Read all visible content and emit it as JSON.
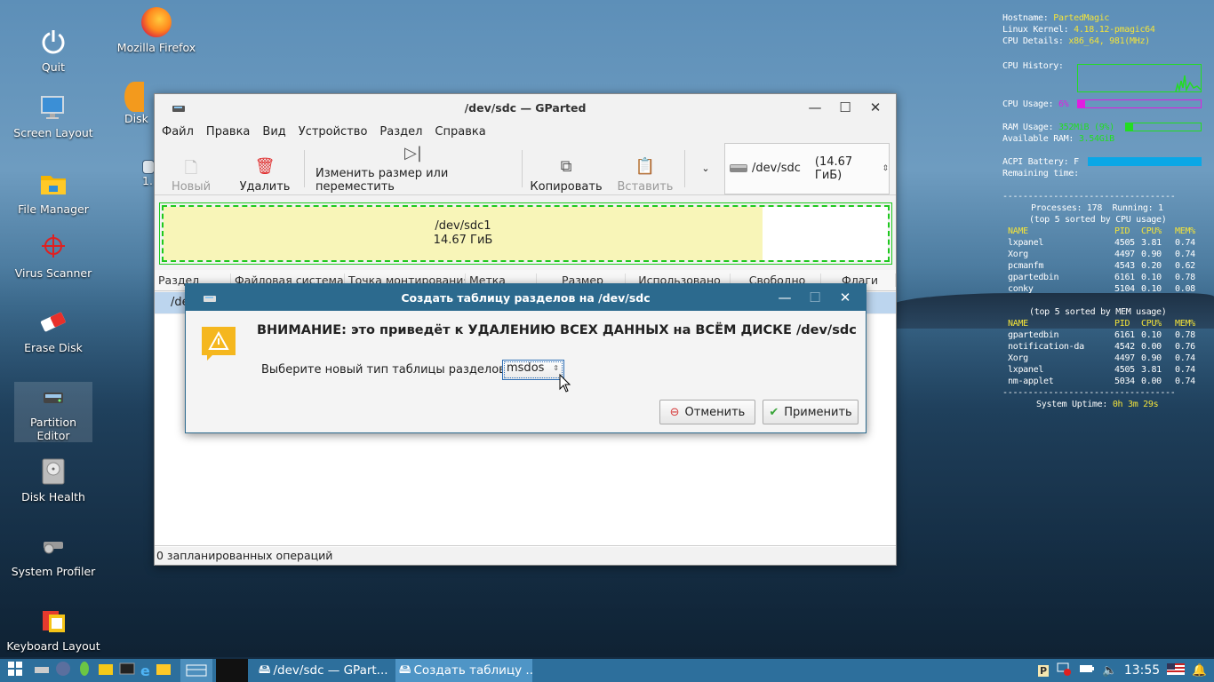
{
  "desktop": {
    "icons": [
      {
        "label": "Quit",
        "icon": "power-icon"
      },
      {
        "label": "Mozilla Firefox",
        "icon": "firefox-icon"
      },
      {
        "label": "Screen Layout",
        "icon": "monitor-icon"
      },
      {
        "label": "Disk",
        "icon": "disk-icon"
      },
      {
        "label": "File Manager",
        "icon": "folder-icon"
      },
      {
        "label": "Virus Scanner",
        "icon": "crosshair-icon"
      },
      {
        "label": "Erase Disk",
        "icon": "eraser-icon"
      },
      {
        "label": "Partition Editor",
        "icon": "partition-icon"
      },
      {
        "label": "Disk Health",
        "icon": "harddisk-icon"
      },
      {
        "label": "System Profiler",
        "icon": "gear-icon"
      },
      {
        "label": "Keyboard Layout",
        "icon": "keyboard-icon"
      },
      {
        "label": "1.",
        "icon": "file-icon"
      }
    ]
  },
  "gparted": {
    "title": "/dev/sdc — GParted",
    "menu": [
      "Файл",
      "Правка",
      "Вид",
      "Устройство",
      "Раздел",
      "Справка"
    ],
    "toolbar": {
      "new": "Новый",
      "delete": "Удалить",
      "resize": "Изменить размер или переместить",
      "copy": "Копировать",
      "paste": "Вставить"
    },
    "device_selector": {
      "device": "/dev/sdc",
      "size": "(14.67 ГиБ)"
    },
    "partition": {
      "name": "/dev/sdc1",
      "size": "14.67 ГиБ"
    },
    "columns": [
      "Раздел",
      "Файловая система",
      "Точка монтирования",
      "Метка",
      "Размер",
      "Использовано",
      "Свободно",
      "Флаги"
    ],
    "row_partial": "/de",
    "status": "0 запланированных операций"
  },
  "dialog": {
    "title": "Создать таблицу разделов на /dev/sdc",
    "warning": "ВНИМАНИЕ: это приведёт к УДАЛЕНИЮ ВСЕХ ДАННЫХ на ВСЁМ ДИСКЕ /dev/sdc",
    "select_label": "Выберите новый тип таблицы разделов:",
    "select_value": "msdos",
    "cancel": "Отменить",
    "apply": "Применить"
  },
  "conky": {
    "hostname_label": "Hostname: ",
    "hostname": "PartedMagic",
    "kernel_label": "Linux Kernel: ",
    "kernel": "4.18.12-pmagic64",
    "cpu_label": "CPU Details: ",
    "cpu": "x86_64, 981(MHz)",
    "cpu_history": "CPU History:",
    "cpu_usage_label": "CPU Usage: ",
    "cpu_usage": "6%",
    "cpu_usage_frac": 0.06,
    "ram_label": "RAM Usage: ",
    "ram": "352MiB (9%)",
    "ram_frac": 0.09,
    "avail_label": "Available RAM: ",
    "avail": "3.54GiB",
    "battery_label": "ACPI Battery: F",
    "battery_frac": 1.0,
    "remaining": "Remaining time:",
    "dashes": "----------------------------------",
    "processes": "Processes: 178  Running: 1",
    "top_cpu": "(top 5 sorted by CPU usage)",
    "header": [
      "NAME",
      "PID",
      "CPU%",
      "MEM%"
    ],
    "cpu_rows": [
      [
        "lxpanel",
        "4505",
        "3.81",
        "0.74"
      ],
      [
        "Xorg",
        "4497",
        "0.90",
        "0.74"
      ],
      [
        "pcmanfm",
        "4543",
        "0.20",
        "0.62"
      ],
      [
        "gpartedbin",
        "6161",
        "0.10",
        "0.78"
      ],
      [
        "conky",
        "5104",
        "0.10",
        "0.08"
      ]
    ],
    "top_mem": "(top 5 sorted by MEM usage)",
    "mem_rows": [
      [
        "gpartedbin",
        "6161",
        "0.10",
        "0.78"
      ],
      [
        "notification-da",
        "4542",
        "0.00",
        "0.76"
      ],
      [
        "Xorg",
        "4497",
        "0.90",
        "0.74"
      ],
      [
        "lxpanel",
        "4505",
        "3.81",
        "0.74"
      ],
      [
        "nm-applet",
        "5034",
        "0.00",
        "0.74"
      ]
    ],
    "uptime_label": "System Uptime: ",
    "uptime": "0h 3m 29s"
  },
  "taskbar": {
    "task1": "/dev/sdc — GPart...",
    "task2": "Создать таблицу ...",
    "clock": "13:55"
  },
  "colors": {
    "partition_fill": "#f8f5b8",
    "partition_border": "#1ec81e",
    "dialog_title": "#2c6a8e",
    "taskbar": "#2d6f9c",
    "cpu_bar": "#e01ee0",
    "ram_bar": "#22dd22",
    "battery_bar": "#0aa7e6"
  }
}
